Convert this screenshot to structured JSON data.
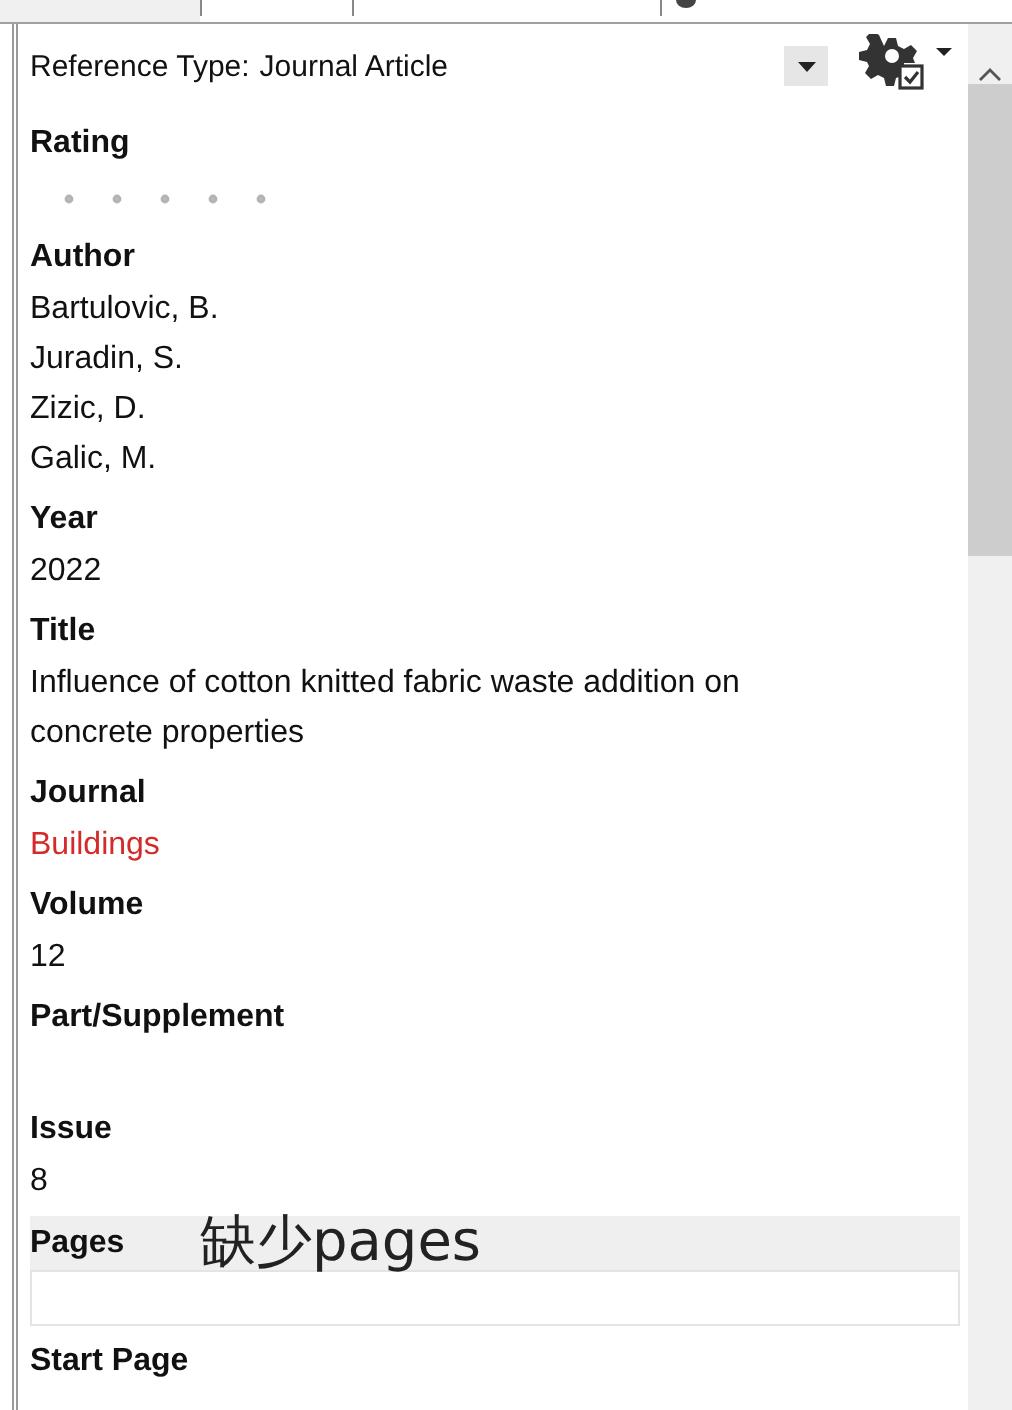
{
  "reference_type": {
    "label": "Reference Type:",
    "value": "Journal Article"
  },
  "fields": [
    {
      "label": "Rating",
      "kind": "rating",
      "stars": 0
    },
    {
      "label": "Author",
      "kind": "text",
      "values": [
        "Bartulovic, B.",
        "Juradin, S.",
        "Zizic, D.",
        "Galic, M."
      ]
    },
    {
      "label": "Year",
      "kind": "text",
      "values": [
        "2022"
      ]
    },
    {
      "label": "Title",
      "kind": "text",
      "values": [
        "Influence of cotton knitted fabric waste addition on concrete properties"
      ]
    },
    {
      "label": "Journal",
      "kind": "text",
      "values": [
        "Buildings"
      ],
      "color": "#d42a2a"
    },
    {
      "label": "Volume",
      "kind": "text",
      "values": [
        "12"
      ]
    },
    {
      "label": "Part/Supplement",
      "kind": "text"
    },
    {
      "label": "Issue",
      "kind": "text",
      "values": [
        "8"
      ]
    },
    {
      "label": "Pages",
      "kind": "text",
      "selected": true,
      "annotation": "缺少pages"
    },
    {
      "label": "Start Page",
      "kind": "text"
    }
  ]
}
